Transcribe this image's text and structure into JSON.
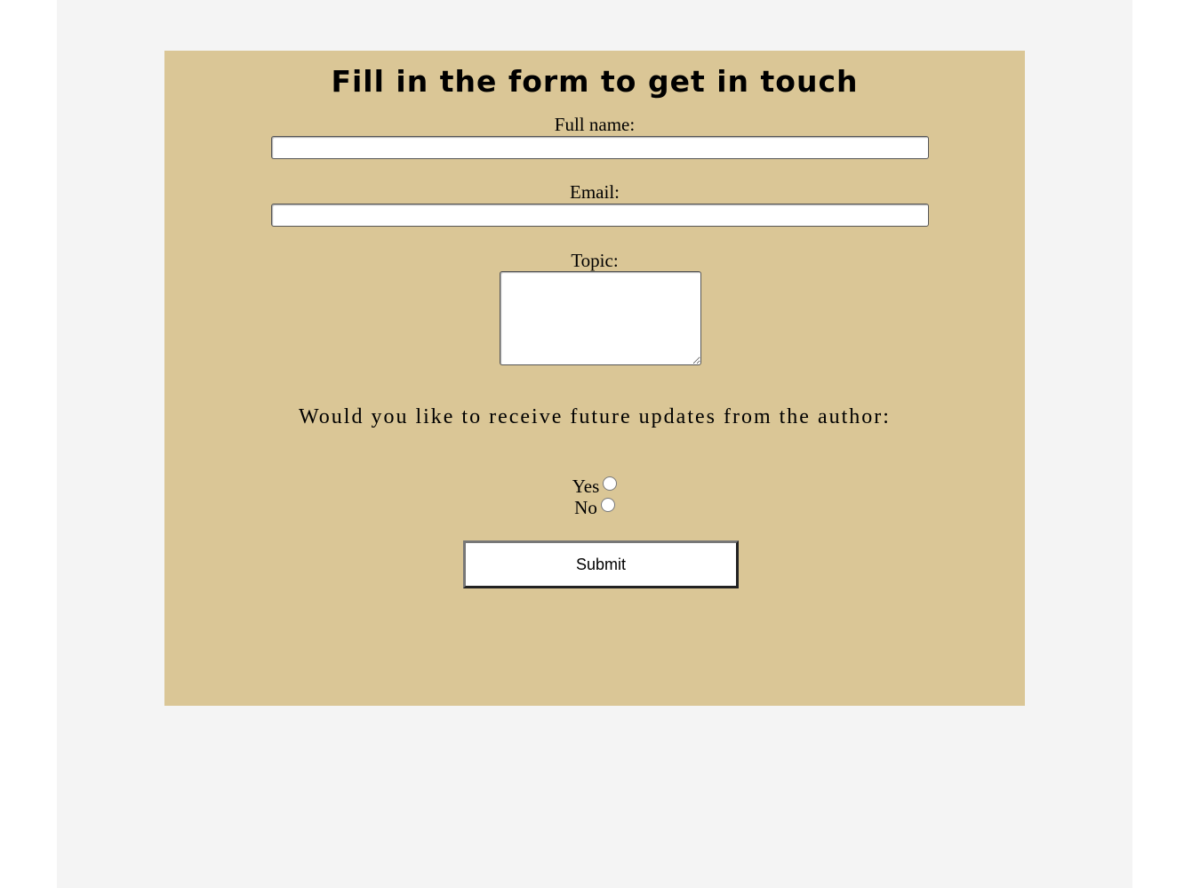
{
  "form": {
    "title": "Fill in the form to get in touch",
    "fields": {
      "full_name": {
        "label": "Full name:",
        "value": "",
        "placeholder": ""
      },
      "email": {
        "label": "Email:",
        "value": "",
        "placeholder": ""
      },
      "topic": {
        "label": "Topic:",
        "value": "",
        "placeholder": ""
      }
    },
    "updates": {
      "question": "Would you like to receive future updates from the author:",
      "options": [
        {
          "label": "Yes",
          "checked": false
        },
        {
          "label": "No",
          "checked": false
        }
      ]
    },
    "submit_label": "Submit"
  },
  "colors": {
    "page_background": "#f4f4f4",
    "panel_background": "#dac696",
    "text": "#000000"
  }
}
